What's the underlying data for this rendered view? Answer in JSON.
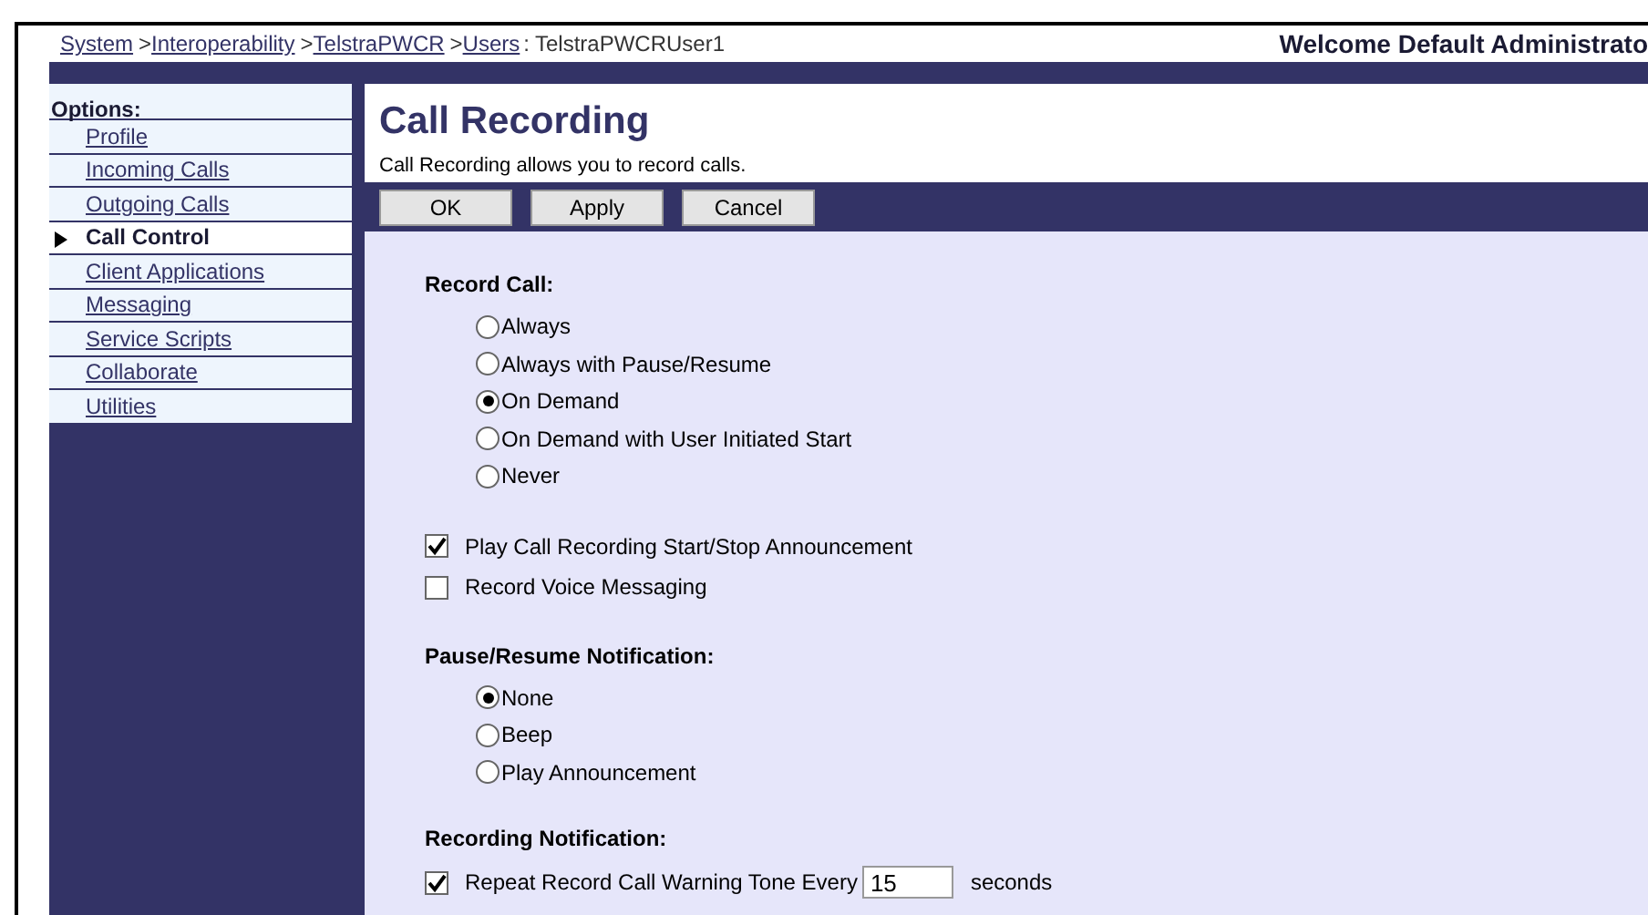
{
  "breadcrumb": [
    {
      "label": "System",
      "link": true
    },
    {
      "separator": ">",
      "label": "Interoperability",
      "link": true
    },
    {
      "separator": ">",
      "label": "TelstraPWCR",
      "link": true
    },
    {
      "separator": ">",
      "label": "Users",
      "link": true
    },
    {
      "separator": ":",
      "label": "TelstraPWCRUser1",
      "link": false
    }
  ],
  "welcome": "Welcome Default Administrato",
  "sidebar": {
    "title": "Options:",
    "items": [
      {
        "label": "Profile",
        "selected": false
      },
      {
        "label": "Incoming Calls",
        "selected": false
      },
      {
        "label": "Outgoing Calls",
        "selected": false
      },
      {
        "label": "Call Control",
        "selected": true
      },
      {
        "label": "Client Applications",
        "selected": false
      },
      {
        "label": "Messaging",
        "selected": false
      },
      {
        "label": "Service Scripts",
        "selected": false
      },
      {
        "label": "Collaborate",
        "selected": false
      },
      {
        "label": "Utilities",
        "selected": false
      }
    ]
  },
  "page": {
    "title": "Call Recording",
    "description": "Call Recording allows you to record calls."
  },
  "buttons": [
    "OK",
    "Apply",
    "Cancel"
  ],
  "sections": [
    {
      "kind": "radio",
      "heading": "Record Call:",
      "options": [
        {
          "label": "Always",
          "selected": false
        },
        {
          "label": "Always with Pause/Resume",
          "selected": false
        },
        {
          "label": "On Demand",
          "selected": true
        },
        {
          "label": "On Demand with User Initiated Start",
          "selected": false
        },
        {
          "label": "Never",
          "selected": false
        }
      ]
    },
    {
      "kind": "checkbox",
      "options": [
        {
          "label": "Play Call Recording Start/Stop Announcement",
          "checked": true
        },
        {
          "label": "Record Voice Messaging",
          "checked": false
        }
      ]
    },
    {
      "kind": "radio",
      "heading": "Pause/Resume Notification:",
      "options": [
        {
          "label": "None",
          "selected": true
        },
        {
          "label": "Beep",
          "selected": false
        },
        {
          "label": "Play Announcement",
          "selected": false
        }
      ]
    },
    {
      "kind": "checkbox",
      "heading": "Recording Notification:",
      "options": [
        {
          "label": "Repeat Record Call Warning Tone Every",
          "checked": true,
          "value": "15",
          "suffix": "seconds"
        }
      ]
    }
  ]
}
